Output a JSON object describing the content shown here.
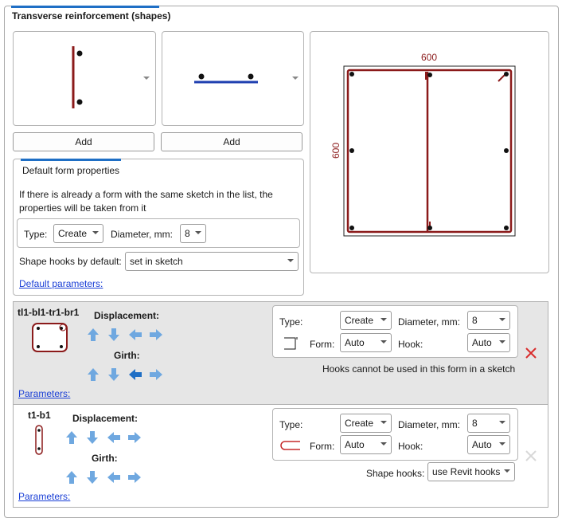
{
  "section": {
    "title": "Transverse reinforcement (shapes)"
  },
  "shape_pickers": [
    {
      "add_label": "Add"
    },
    {
      "add_label": "Add"
    }
  ],
  "preview": {
    "width_label": "600",
    "height_label": "600"
  },
  "defaults": {
    "title": "Default form properties",
    "info_line1": "If there is already a form with the same sketch in the list, the",
    "info_line2": "properties will be taken from it",
    "type_label": "Type:",
    "type_value": "Create",
    "diameter_label": "Diameter, mm:",
    "diameter_value": "8",
    "hooks_label": "Shape hooks by default:",
    "hooks_value": "set in sketch",
    "params_link": "Default parameters:"
  },
  "rows": [
    {
      "name": "tl1-bl1-tr1-br1",
      "displacement_label": "Displacement:",
      "girth_label": "Girth:",
      "params_link": "Parameters:",
      "type_label": "Type:",
      "type_value": "Create",
      "diameter_label": "Diameter, mm:",
      "diameter_value": "8",
      "form_label": "Form:",
      "form_value": "Auto",
      "hook_label": "Hook:",
      "hook_value": "Auto",
      "message": "Hooks cannot be used in this form in a sketch",
      "delete_color": "#d92c2c"
    },
    {
      "name": "t1-b1",
      "displacement_label": "Displacement:",
      "girth_label": "Girth:",
      "params_link": "Parameters:",
      "type_label": "Type:",
      "type_value": "Create",
      "diameter_label": "Diameter, mm:",
      "diameter_value": "8",
      "form_label": "Form:",
      "form_value": "Auto",
      "hook_label": "Hook:",
      "hook_value": "Auto",
      "shape_hooks_label": "Shape hooks:",
      "shape_hooks_value": "use Revit hooks",
      "delete_color": "#d8d8d8"
    }
  ],
  "colors": {
    "accent": "#1f6fc5",
    "rebar": "#8b1a1a",
    "arrow": "#6fa8e0",
    "arrow_active": "#1f6fc5",
    "selected_row": "#e6e6e6"
  }
}
